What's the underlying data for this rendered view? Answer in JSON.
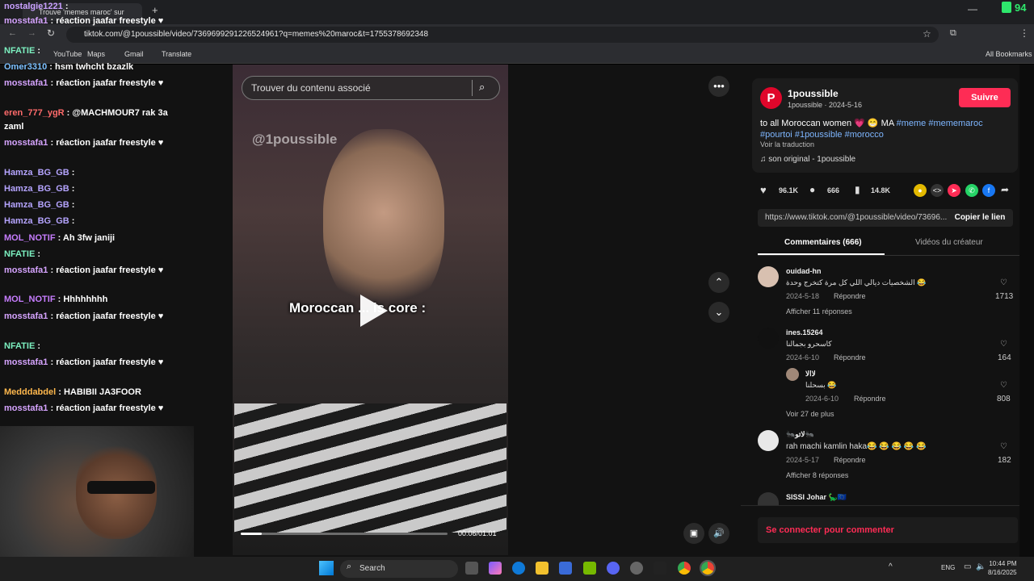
{
  "browser": {
    "tab_title": "Trouve 'memes maroc' sur",
    "new_tab": "+",
    "url": "tiktok.com/@1poussible/video/7369699291226524961?q=memes%20maroc&t=1755378692348",
    "bookmarks": [
      "YouTube",
      "Maps",
      "Gmail",
      "Translate"
    ],
    "all_bookmarks": "All Bookmarks",
    "counter": "94"
  },
  "chat": [
    {
      "user": "nostalgie1221",
      "color": "#c9a0ff",
      "msg": ":"
    },
    {
      "user": "mosstafa1",
      "color": "#d6a4ff",
      "msg": ": réaction jaafar freestyle ♥"
    },
    {
      "user": "NFATIE",
      "color": "#7cf0c0",
      "msg": ":"
    },
    {
      "user": "Omer3310",
      "color": "#7cc0ff",
      "msg": ": hsm twhcht bzazlk"
    },
    {
      "user": "mosstafa1",
      "color": "#d6a4ff",
      "msg": ": réaction jaafar freestyle ♥"
    },
    {
      "user": "eren_777_ygR",
      "color": "#ff6b6b",
      "msg": ": @MACHMOUR7 rak 3a"
    },
    {
      "user": "",
      "color": "#ffffff",
      "msg": "zaml"
    },
    {
      "user": "mosstafa1",
      "color": "#d6a4ff",
      "msg": ": réaction jaafar freestyle ♥"
    },
    {
      "user": "Hamza_BG_GB",
      "color": "#b5a4ff",
      "msg": ":"
    },
    {
      "user": "Hamza_BG_GB",
      "color": "#b5a4ff",
      "msg": ":"
    },
    {
      "user": "Hamza_BG_GB",
      "color": "#b5a4ff",
      "msg": ":"
    },
    {
      "user": "Hamza_BG_GB",
      "color": "#b5a4ff",
      "msg": ":"
    },
    {
      "user": "MOL_NOTIF",
      "color": "#c77dff",
      "msg": ": Ah 3fw janiji"
    },
    {
      "user": "NFATIE",
      "color": "#7cf0c0",
      "msg": ":"
    },
    {
      "user": "mosstafa1",
      "color": "#d6a4ff",
      "msg": ": réaction jaafar freestyle ♥"
    },
    {
      "user": "MOL_NOTIF",
      "color": "#c77dff",
      "msg": ": Hhhhhhhh"
    },
    {
      "user": "mosstafa1",
      "color": "#d6a4ff",
      "msg": ": réaction jaafar freestyle ♥"
    },
    {
      "user": "NFATIE",
      "color": "#7cf0c0",
      "msg": ":"
    },
    {
      "user": "mosstafa1",
      "color": "#d6a4ff",
      "msg": ": réaction jaafar freestyle ♥"
    },
    {
      "user": "Medddabdel",
      "color": "#ffb84d",
      "msg": ": HABIBII JA3FOOR"
    },
    {
      "user": "mosstafa1",
      "color": "#d6a4ff",
      "msg": ": réaction jaafar freestyle ♥"
    }
  ],
  "video": {
    "search_placeholder": "Trouver du contenu associé",
    "watermark": "@1poussible",
    "caption": "Moroccan ... is core :",
    "time": "00:06/01:01",
    "progress": 0.1
  },
  "post": {
    "creator": "1poussible",
    "creator_sub": "1poussible · 2024-5-16",
    "follow": "Suivre",
    "desc_text": "to all Moroccan women 💗 😁 MA",
    "tags": [
      "#meme",
      "#mememaroc",
      "#pourtoi",
      "#1poussible",
      "#morocco"
    ],
    "translate": "Voir la traduction",
    "sound": "son original - 1poussible",
    "likes": "96.1K",
    "comments": "666",
    "saves": "14.8K",
    "link": "https://www.tiktok.com/@1poussible/video/73696...",
    "copy_link": "Copier le lien",
    "tab_comments": "Commentaires (666)",
    "tab_creator": "Vidéos du créateur",
    "login": "Se connecter pour commenter"
  },
  "comments": [
    {
      "name": "ouidad-hn",
      "text": "الشخصيات ديالي اللي كل مرة كتخرج وحدة 😂",
      "date": "2024-5-18",
      "reply": "Répondre",
      "more": "Afficher 11 réponses",
      "likes": "1713"
    },
    {
      "name": "ines.15264",
      "text": "كاسحرو بجمالنا",
      "date": "2024-6-10",
      "reply": "Répondre",
      "more": "",
      "likes": "164"
    },
    {
      "name": "لاالا",
      "text": "بسحلنا 😂",
      "date": "2024-6-10",
      "reply": "Répondre",
      "more": "Voir 27 de plus",
      "likes": "808"
    },
    {
      "name": "🐜لاتو🐜",
      "text": "rah machi kamlin haka😂 😂 😂 😂 😂",
      "date": "2024-5-17",
      "reply": "Répondre",
      "more": "Afficher 8 réponses",
      "likes": "182"
    },
    {
      "name": "SISSI Johar 🦕🇪🇺",
      "text": "",
      "date": "",
      "reply": "",
      "more": "",
      "likes": ""
    }
  ],
  "taskbar": {
    "search": "Search",
    "lang": "ENG",
    "time": "10:44 PM",
    "date": "8/16/2025"
  }
}
